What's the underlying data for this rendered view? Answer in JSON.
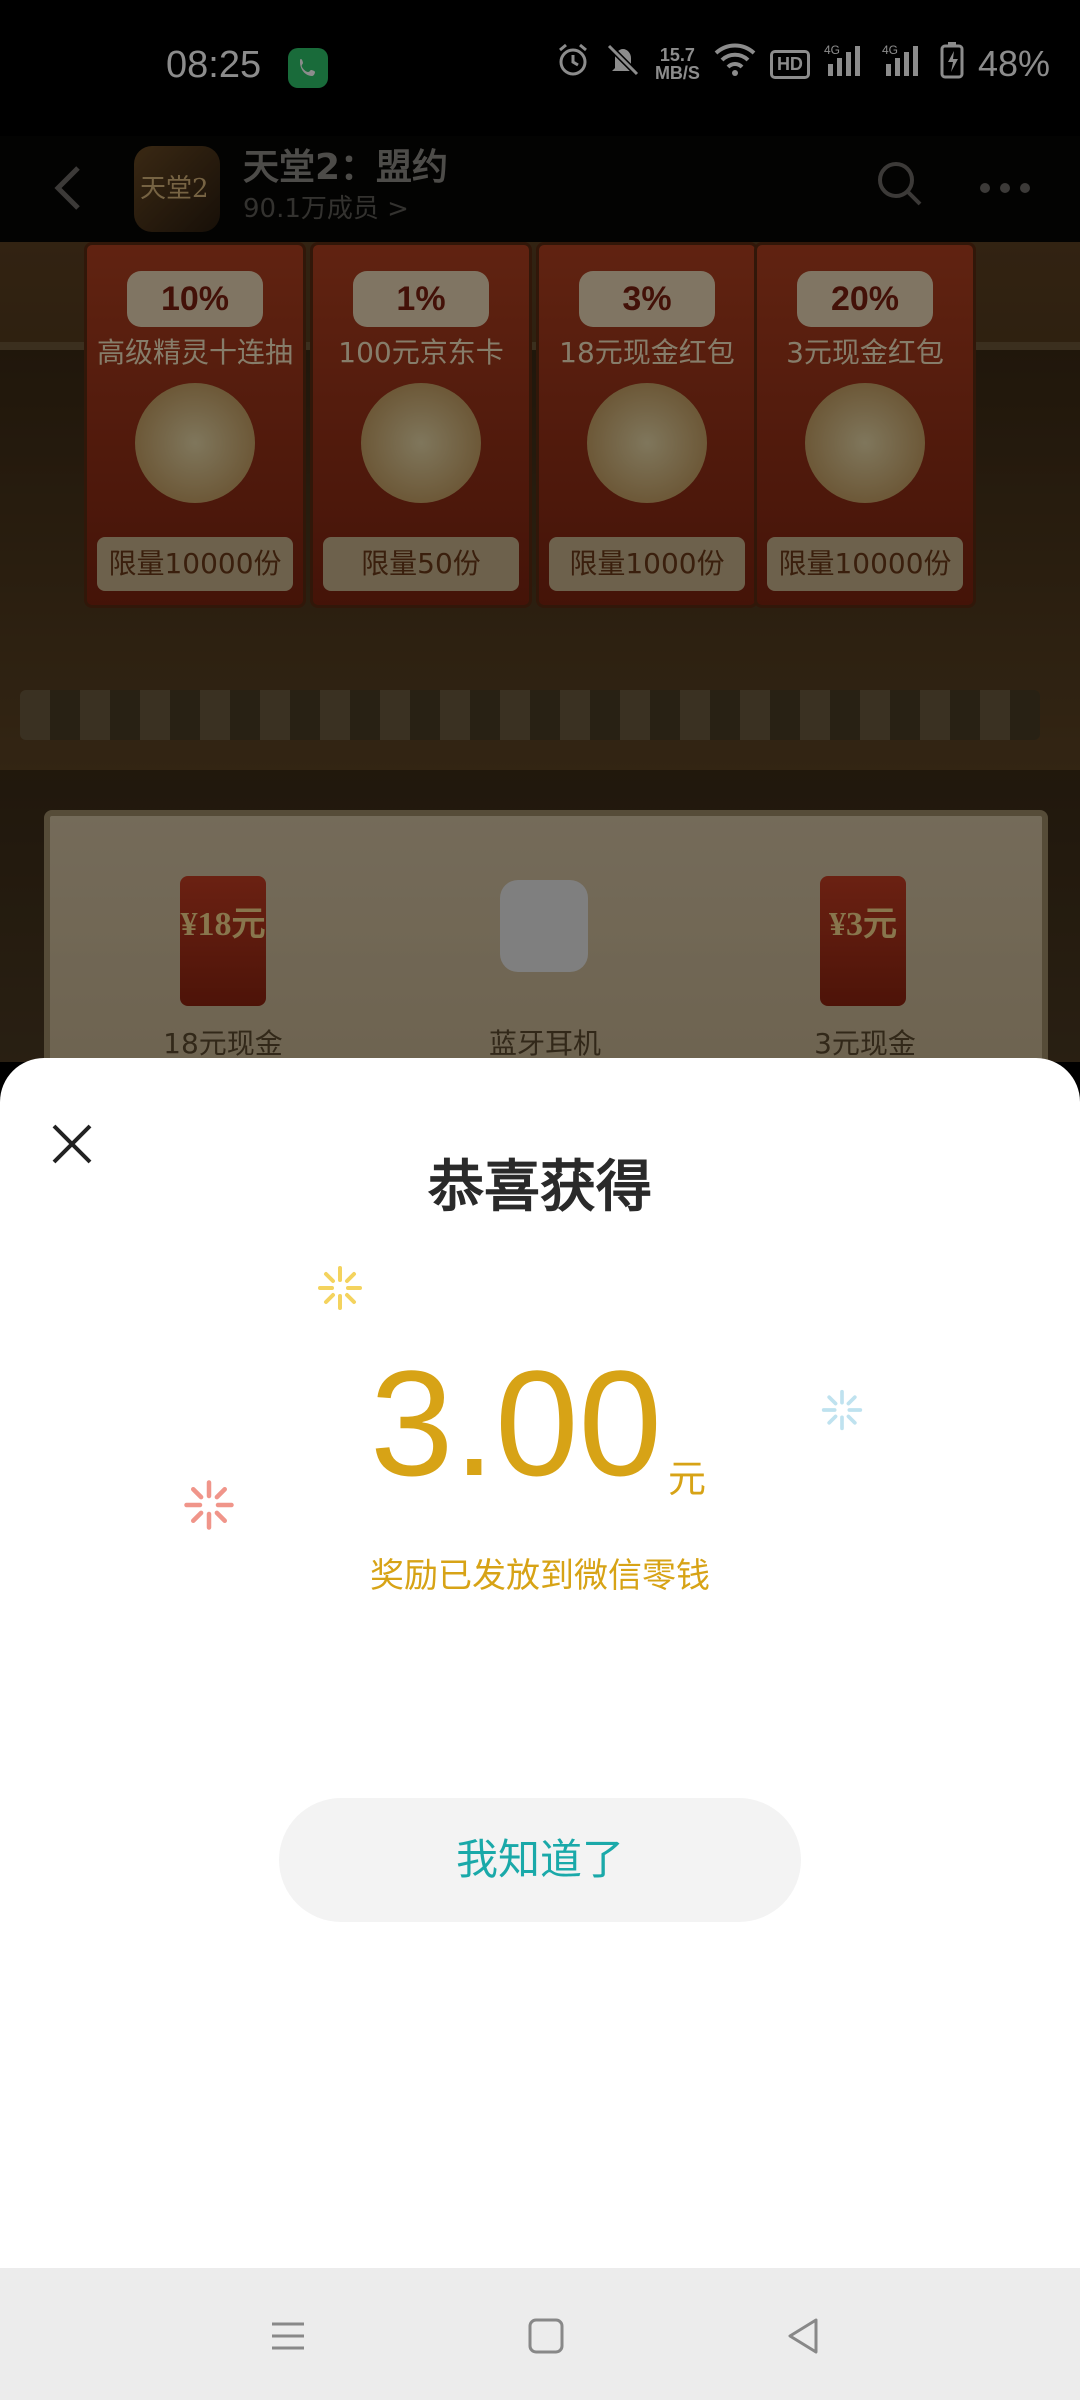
{
  "status_bar": {
    "time": "08:25",
    "network_speed_value": "15.7",
    "network_speed_unit": "MB/S",
    "hd_label": "HD",
    "signal1": "4G",
    "signal2": "4G",
    "battery": "48%"
  },
  "header": {
    "title": "天堂2：盟约",
    "members": "90.1万成员 >",
    "logo_text": "天堂2"
  },
  "banner": {
    "cards": [
      {
        "pct": "10%",
        "name": "高级精灵十连抽",
        "qty": "限量10000份"
      },
      {
        "pct": "1%",
        "name": "100元京东卡",
        "qty": "限量50份"
      },
      {
        "pct": "3%",
        "name": "18元现金红包",
        "qty": "限量1000份"
      },
      {
        "pct": "20%",
        "name": "3元现金红包",
        "qty": "限量10000份"
      }
    ],
    "rewards": [
      {
        "icon_text": "¥18元",
        "label": "18元现金"
      },
      {
        "icon_text": "",
        "label": "蓝牙耳机"
      },
      {
        "icon_text": "¥3元",
        "label": "3元现金"
      }
    ]
  },
  "dialog": {
    "title": "恭喜获得",
    "amount": "3.00",
    "unit": "元",
    "message": "奖励已发放到微信零钱",
    "confirm_label": "我知道了"
  },
  "colors": {
    "accent_gold": "#d7a316",
    "button_text": "#1aa9a9"
  }
}
